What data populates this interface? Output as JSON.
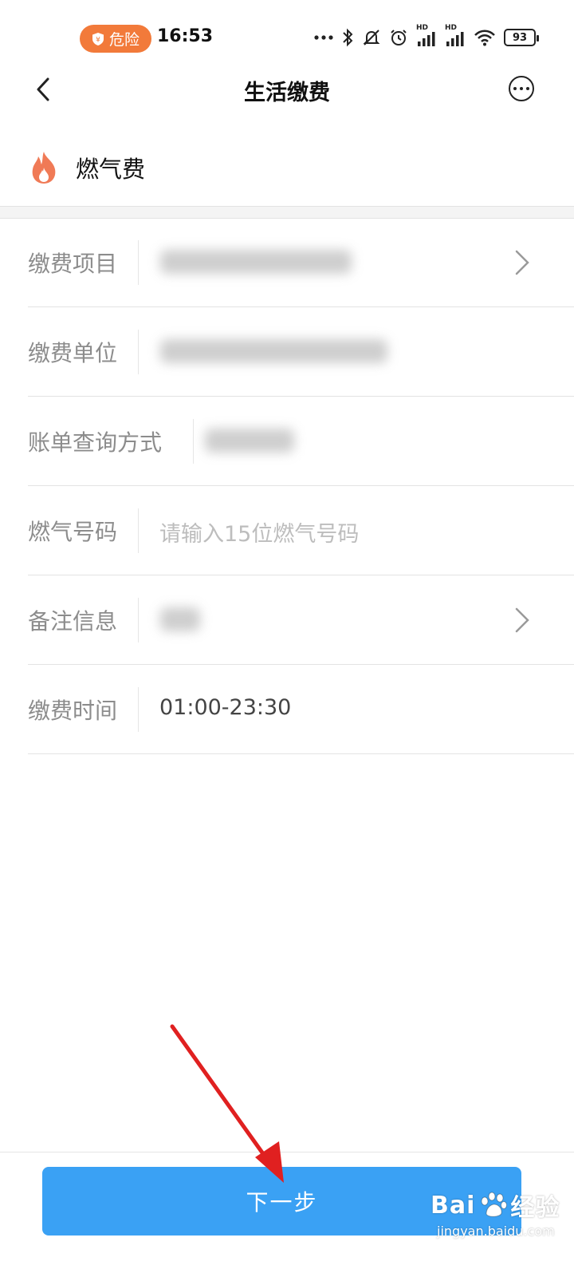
{
  "status_bar": {
    "danger_label": "危险",
    "time": "16:53",
    "battery": "93",
    "network_labels": [
      "HD",
      "HD"
    ]
  },
  "nav": {
    "title": "生活缴费"
  },
  "category": {
    "label": "燃气费",
    "icon": "fire-icon",
    "icon_color": "#f07a56"
  },
  "form": {
    "rows": [
      {
        "label": "缴费项目",
        "value": "",
        "has_chevron": true
      },
      {
        "label": "缴费单位",
        "value": ""
      },
      {
        "label": "账单查询方式",
        "value": ""
      },
      {
        "label": "燃气号码",
        "placeholder": "请输入15位燃气号码"
      },
      {
        "label": "备注信息",
        "value": "",
        "has_chevron": true
      },
      {
        "label": "缴费时间",
        "value": "01:00-23:30"
      }
    ]
  },
  "actions": {
    "next_label": "下一步",
    "next_color": "#3aa1f4"
  },
  "annotation": {
    "arrow_color": "#e02020"
  },
  "watermark": {
    "brand": "Bai",
    "brand2": "经验",
    "url": "jingyan.baidu.com"
  }
}
